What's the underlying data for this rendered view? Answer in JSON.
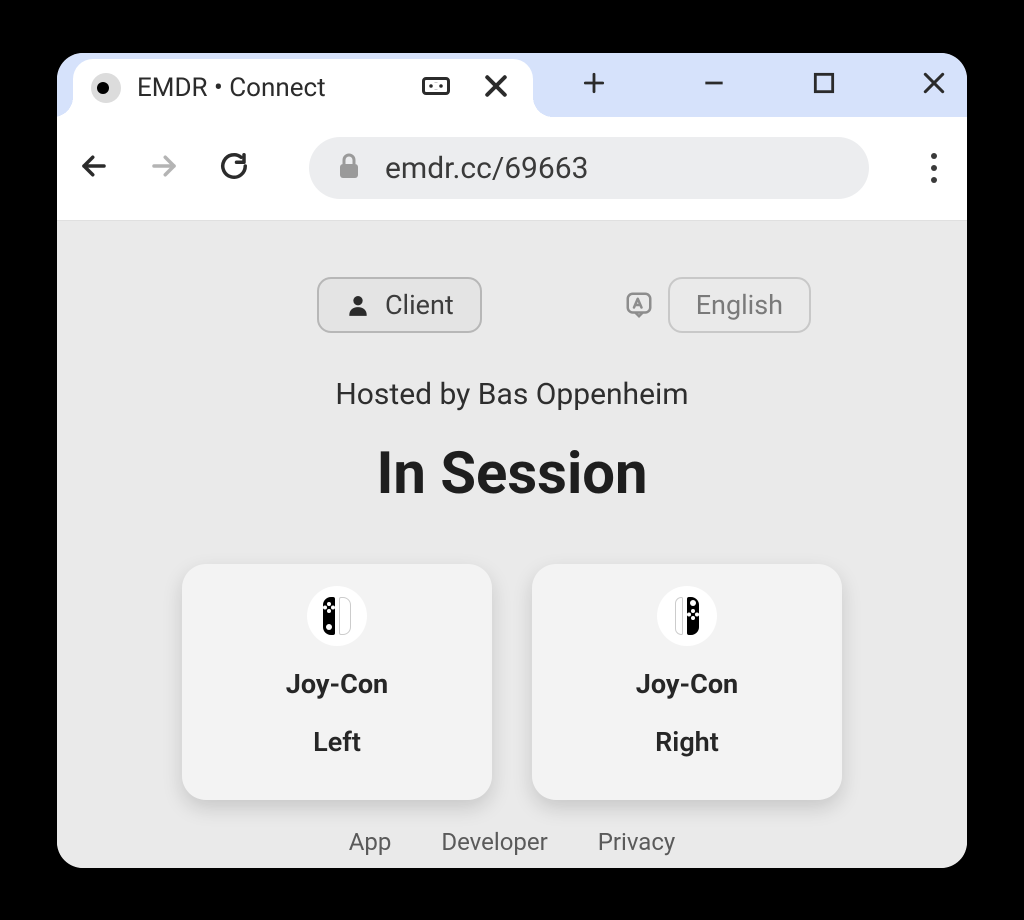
{
  "browser": {
    "tab_title": "EMDR • Connect",
    "url": "emdr.cc/69663"
  },
  "top": {
    "client_label": "Client",
    "language_label": "English"
  },
  "main": {
    "hosted_by": "Hosted by Bas Oppenheim",
    "status": "In Session",
    "cards": [
      {
        "title": "Joy-Con",
        "subtitle": "Left"
      },
      {
        "title": "Joy-Con",
        "subtitle": "Right"
      }
    ]
  },
  "footer": {
    "links": [
      "App",
      "Developer",
      "Privacy"
    ]
  }
}
